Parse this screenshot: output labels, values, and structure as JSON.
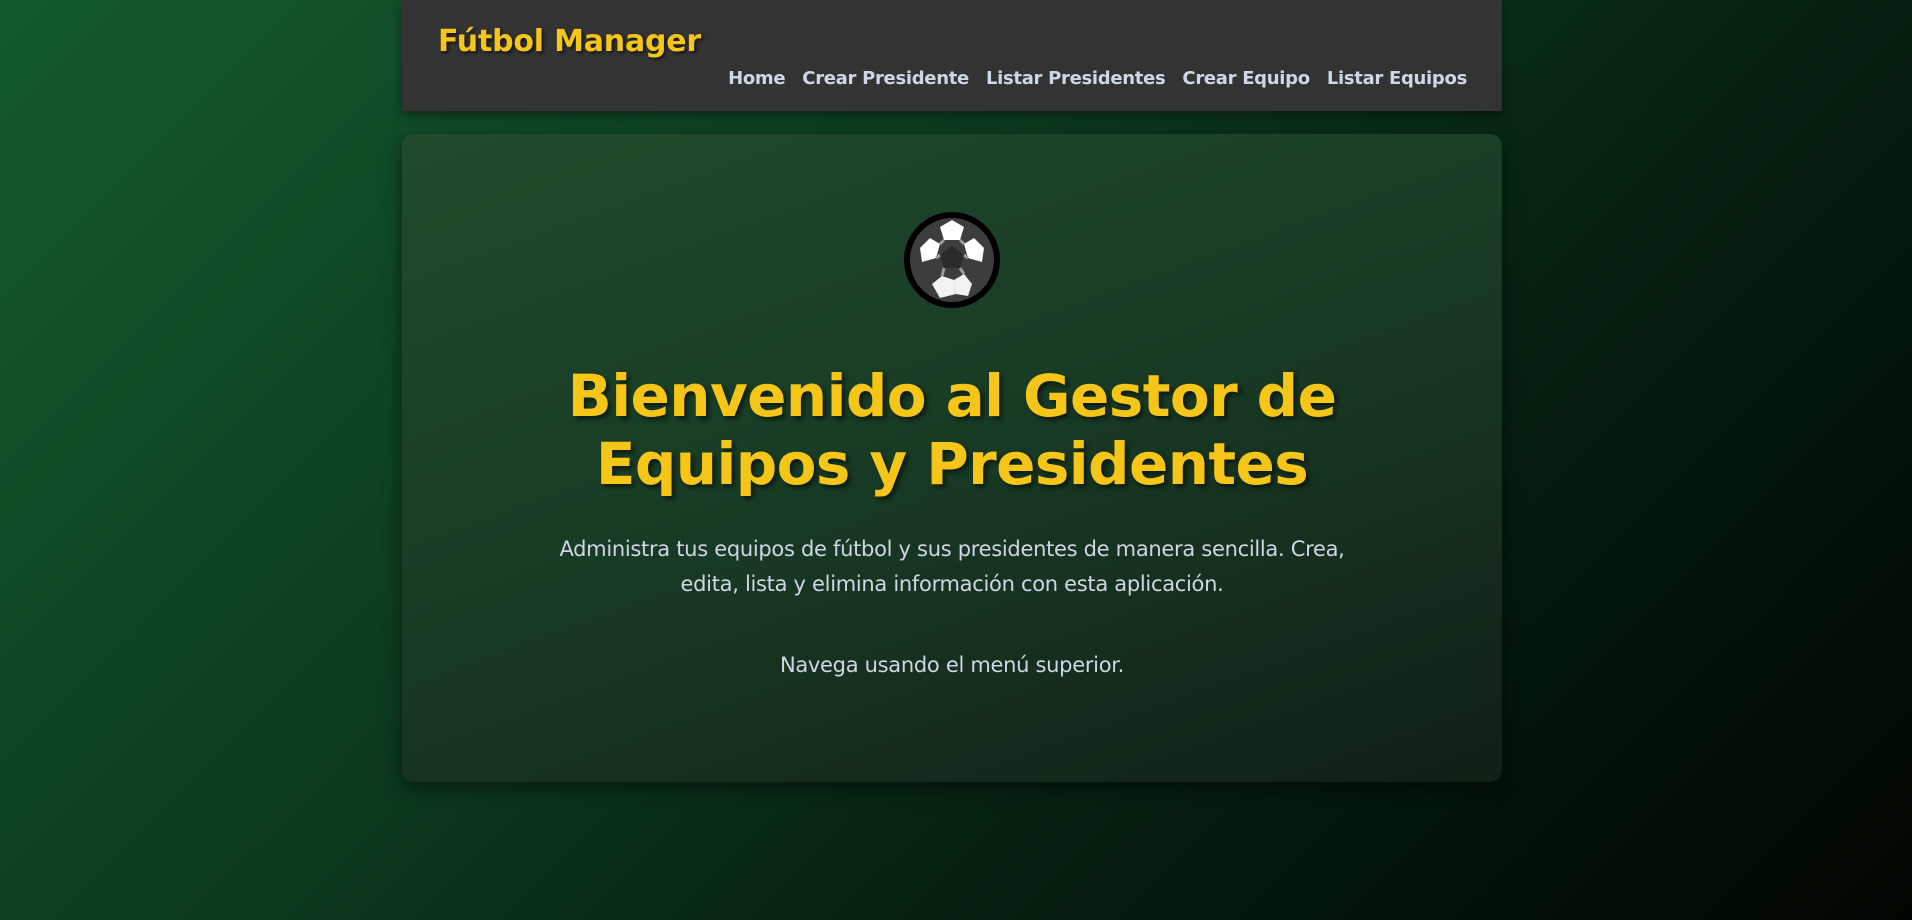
{
  "header": {
    "brand": "Fútbol Manager",
    "nav": [
      {
        "label": "Home"
      },
      {
        "label": "Crear Presidente"
      },
      {
        "label": "Listar Presidentes"
      },
      {
        "label": "Crear Equipo"
      },
      {
        "label": "Listar Equipos"
      }
    ]
  },
  "main": {
    "icon": "soccer-ball-icon",
    "title": "Bienvenido al Gestor de Equipos y Presidentes",
    "description": "Administra tus equipos de fútbol y sus presidentes de manera sencilla. Crea, edita, lista y elimina información con esta aplicación.",
    "hint": "Navega usando el menú superior."
  },
  "colors": {
    "accent": "#f5c518",
    "header_bg": "#333333",
    "text_light": "#cfd6e6",
    "background_dark_green": "#0c3a1f"
  }
}
